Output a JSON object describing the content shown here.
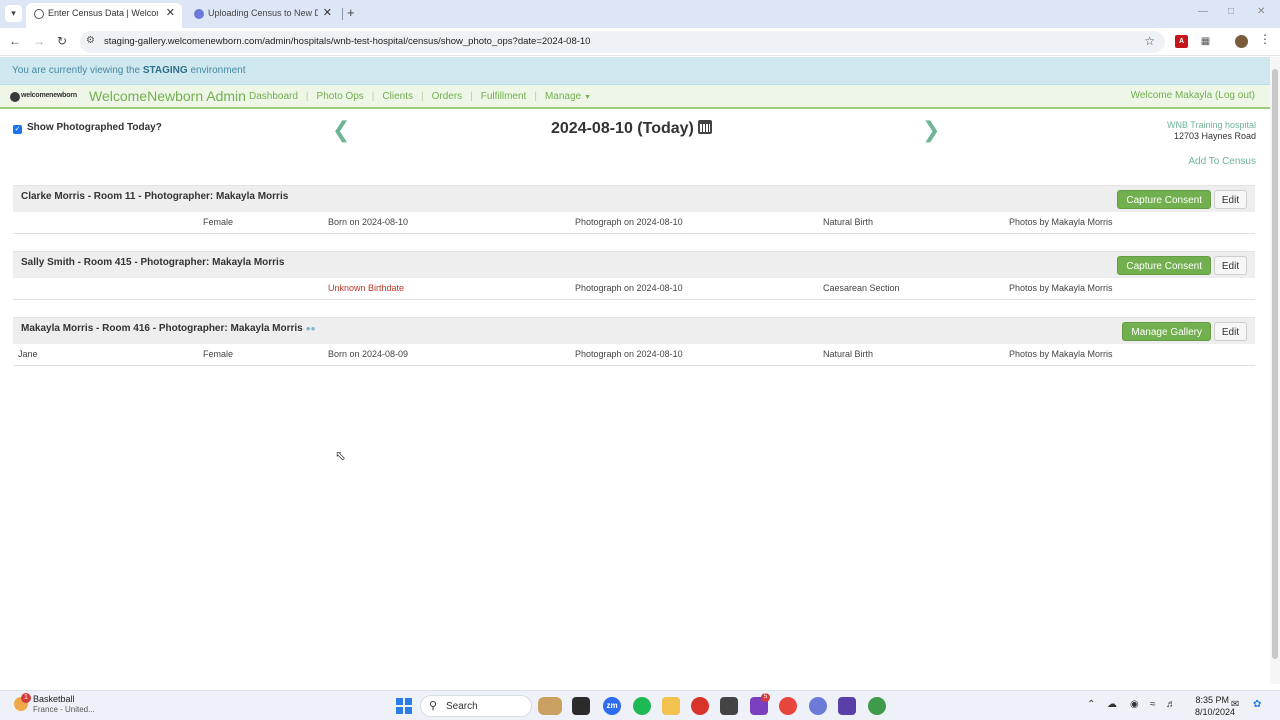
{
  "browser": {
    "tabs": [
      {
        "title": "Enter Census Data | WelcomeN",
        "active": true
      },
      {
        "title": "Uploading Census to New Dash",
        "active": false
      }
    ],
    "new_tab": "+",
    "url": "staging-gallery.welcomenewborn.com/admin/hospitals/wnb-test-hospital/census/show_photo_ops?date=2024-08-10",
    "icons": [
      "tab-search-icon",
      "back-icon",
      "forward-icon",
      "reload-icon",
      "site-info-icon",
      "bookmark-star-icon",
      "pdf-extension-icon",
      "extensions-icon",
      "profile-avatar",
      "menu-kebab-icon"
    ]
  },
  "staging": {
    "prefix": "You are currently viewing the",
    "env": "STAGING",
    "suffix": "environment"
  },
  "nav": {
    "logo_text": "welcomenewborn",
    "brand": "WelcomeNewborn Admin",
    "items": [
      "Dashboard",
      "Photo Ops",
      "Clients",
      "Orders",
      "Fulfillment",
      "Manage"
    ],
    "welcome_prefix": "Welcome Makayla",
    "logout": "(Log out)"
  },
  "header": {
    "show_today_label": "Show Photographed Today?",
    "show_today_checked": true,
    "date_title": "2024-08-10 (Today)",
    "hospital_name": "WNB Training hospital",
    "hospital_address": "12703 Haynes Road",
    "add_to_census": "Add To Census"
  },
  "records": [
    {
      "title": "Clarke Morris - Room 11 - Photographer: Makayla Morris",
      "has_chat_icon": false,
      "primary_button": "Capture Consent",
      "edit_button": "Edit",
      "first_name": "",
      "gender": "Female",
      "birth": "Born on 2024-08-10",
      "birth_unknown": false,
      "photograph": "Photograph on 2024-08-10",
      "birth_type": "Natural Birth",
      "photos_by": "Photos by Makayla Morris"
    },
    {
      "title": "Sally Smith - Room 415 - Photographer: Makayla Morris",
      "has_chat_icon": false,
      "primary_button": "Capture Consent",
      "edit_button": "Edit",
      "first_name": "",
      "gender": "",
      "birth": "Unknown Birthdate",
      "birth_unknown": true,
      "photograph": "Photograph on 2024-08-10",
      "birth_type": "Caesarean Section",
      "photos_by": "Photos by Makayla Morris"
    },
    {
      "title": "Makayla Morris - Room 416 - Photographer: Makayla Morris",
      "has_chat_icon": true,
      "primary_button": "Manage Gallery",
      "edit_button": "Edit",
      "first_name": "Jane",
      "gender": "Female",
      "birth": "Born on 2024-08-09",
      "birth_unknown": false,
      "photograph": "Photograph on 2024-08-10",
      "birth_type": "Natural Birth",
      "photos_by": "Photos by Makayla Morris"
    }
  ],
  "taskbar": {
    "weather_badge": "1",
    "weather_title": "Basketball",
    "weather_sub": "France - United...",
    "search_label": "Search",
    "apps": [
      "file-explorer-icon",
      "zoom-icon",
      "spotify-icon",
      "folder-icon",
      "acrobat-icon",
      "pen-icon",
      "chrome-icon",
      "settings-icon",
      "photo-app-icon",
      "chrome-profile-icon"
    ],
    "app_badge": "5",
    "zoom_label": "zm",
    "time": "8:35 PM",
    "date": "8/10/2024"
  }
}
